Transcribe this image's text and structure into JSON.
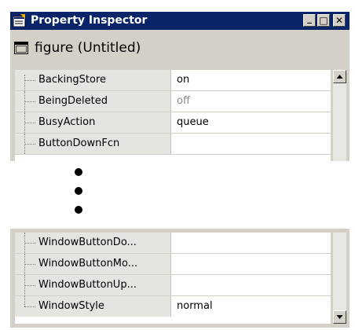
{
  "window": {
    "title": "Property Inspector",
    "minimize_glyph": "_",
    "maximize_glyph": "□",
    "close_glyph": "✕"
  },
  "object": {
    "label": "figure (Untitled)",
    "icon": "figure-window-icon"
  },
  "properties_top": [
    {
      "name": "BackingStore",
      "value": "on",
      "dimmed": false
    },
    {
      "name": "BeingDeleted",
      "value": "off",
      "dimmed": true
    },
    {
      "name": "BusyAction",
      "value": "queue",
      "dimmed": false
    },
    {
      "name": "ButtonDownFcn",
      "value": "",
      "dimmed": false
    }
  ],
  "properties_bottom": [
    {
      "name": "WindowButtonDo...",
      "value": ""
    },
    {
      "name": "WindowButtonMo...",
      "value": ""
    },
    {
      "name": "WindowButtonUp...",
      "value": ""
    },
    {
      "name": "WindowStyle",
      "value": "normal"
    }
  ],
  "colors": {
    "titlebar": "#0a246a",
    "frame": "#d4d0c8",
    "name_column": "#e6e4e0"
  }
}
